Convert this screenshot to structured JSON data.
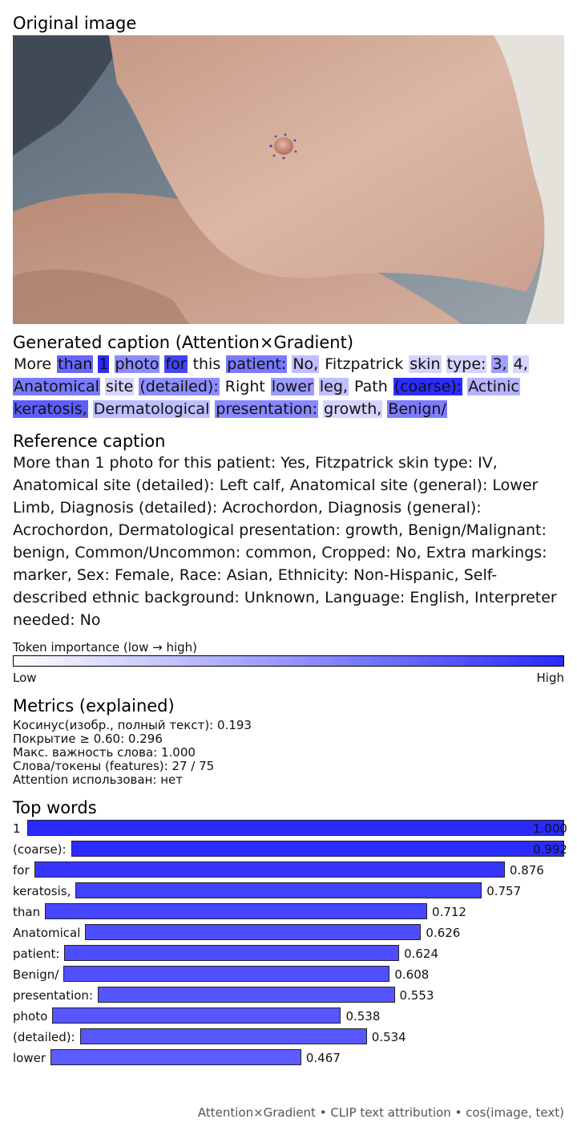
{
  "sections": {
    "original_title": "Original image",
    "generated_title": "Generated caption (Attention×Gradient)",
    "reference_title": "Reference caption",
    "metrics_title": "Metrics (explained)",
    "top_words_title": "Top words"
  },
  "image": {
    "description_icon": "skin-lesion-photo"
  },
  "generated_caption": [
    {
      "t": "More",
      "w": 0.0
    },
    {
      "t": "than",
      "w": 0.712
    },
    {
      "t": "1",
      "w": 1.0
    },
    {
      "t": "photo",
      "w": 0.538
    },
    {
      "t": "for",
      "w": 0.876
    },
    {
      "t": "this",
      "w": 0.0
    },
    {
      "t": "patient:",
      "w": 0.624
    },
    {
      "t": "No,",
      "w": 0.3
    },
    {
      "t": "Fitzpatrick",
      "w": 0.0
    },
    {
      "t": "skin",
      "w": 0.2
    },
    {
      "t": "type:",
      "w": 0.2
    },
    {
      "t": "3,",
      "w": 0.45
    },
    {
      "t": "4,",
      "w": 0.2
    },
    {
      "t": "Anatomical",
      "w": 0.626
    },
    {
      "t": "site",
      "w": 0.2
    },
    {
      "t": "(detailed):",
      "w": 0.534
    },
    {
      "t": "Right",
      "w": 0.0
    },
    {
      "t": "lower",
      "w": 0.467
    },
    {
      "t": "leg,",
      "w": 0.3
    },
    {
      "t": "Path",
      "w": 0.0
    },
    {
      "t": "(coarse):",
      "w": 0.992
    },
    {
      "t": "Actinic",
      "w": 0.35
    },
    {
      "t": "keratosis,",
      "w": 0.757
    },
    {
      "t": "Dermatological",
      "w": 0.3
    },
    {
      "t": "presentation:",
      "w": 0.553
    },
    {
      "t": "growth,",
      "w": 0.2
    },
    {
      "t": "Benign/",
      "w": 0.608
    }
  ],
  "reference_caption": "More than 1 photo for this patient: Yes, Fitzpatrick skin type: IV, Anatomical site (detailed): Left calf, Anatomical site (general): Lower Limb, Diagnosis (detailed): Acrochordon, Diagnosis (general): Acrochordon, Dermatological presentation: growth, Benign/Malignant: benign, Common/Uncommon: common, Cropped: No, Extra markings: marker, Sex: Female, Race: Asian, Ethnicity: Non-Hispanic, Self-described ethnic background: Unknown, Language: English, Interpreter needed: No",
  "legend": {
    "label": "Token importance (low → high)",
    "low": "Low",
    "high": "High",
    "low_color": "#ffffff",
    "high_color": "#2a2aff"
  },
  "metrics": [
    "Косинус(изобр., полный текст): 0.193",
    "Покрытие ≥ 0.60: 0.296",
    "Макс. важность слова: 1.000",
    "Слова/токены (features): 27 / 75",
    "Attention использован: нет"
  ],
  "chart_data": {
    "type": "bar",
    "orientation": "horizontal",
    "title": "Top words",
    "categories": [
      "1",
      "(coarse):",
      "for",
      "keratosis,",
      "than",
      "Anatomical",
      "patient:",
      "Benign/",
      "presentation:",
      "photo",
      "(detailed):",
      "lower"
    ],
    "values": [
      1.0,
      0.992,
      0.876,
      0.757,
      0.712,
      0.626,
      0.624,
      0.608,
      0.553,
      0.538,
      0.534,
      0.467
    ],
    "value_labels": [
      "1.000",
      "0.992",
      "0.876",
      "0.757",
      "0.712",
      "0.626",
      "0.624",
      "0.608",
      "0.553",
      "0.538",
      "0.534",
      "0.467"
    ],
    "xlim": [
      0,
      1
    ]
  },
  "footer": "Attention×Gradient • CLIP text attribution • cos(image, text)"
}
